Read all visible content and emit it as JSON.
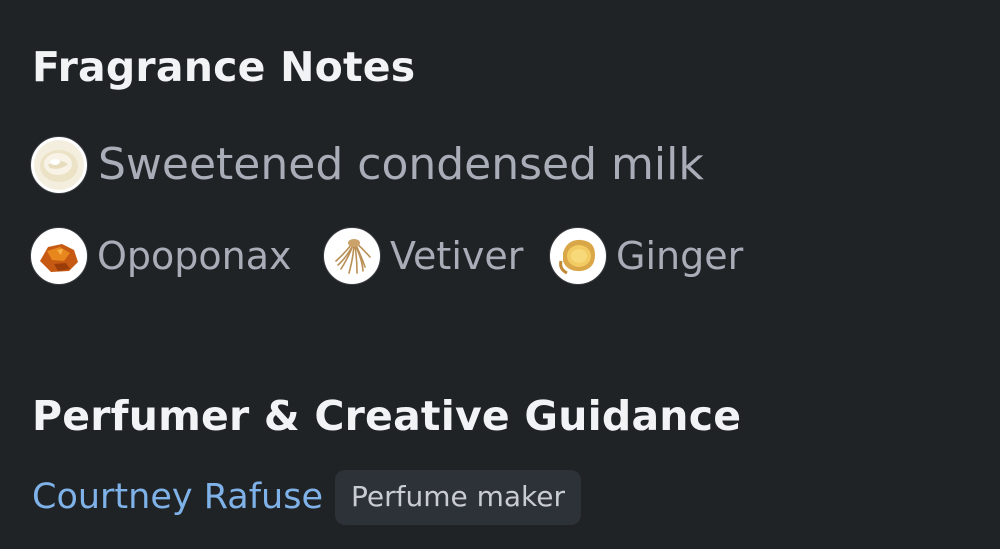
{
  "fragrance_notes": {
    "title": "Fragrance Notes",
    "top_row": [
      {
        "label": "Sweetened condensed milk",
        "icon": "condensed-milk-icon"
      }
    ],
    "second_row": [
      {
        "label": "Opoponax",
        "icon": "opoponax-resin-icon"
      },
      {
        "label": "Vetiver",
        "icon": "vetiver-root-icon"
      },
      {
        "label": "Ginger",
        "icon": "ginger-root-icon"
      }
    ]
  },
  "perfumer": {
    "title": "Perfumer & Creative Guidance",
    "name": "Courtney Rafuse",
    "role": "Perfume maker"
  },
  "colors": {
    "background": "#202326",
    "heading": "#f1f3f5",
    "note_text": "#a9adb8",
    "link": "#7fb2e8",
    "badge_bg": "#2d3238"
  }
}
